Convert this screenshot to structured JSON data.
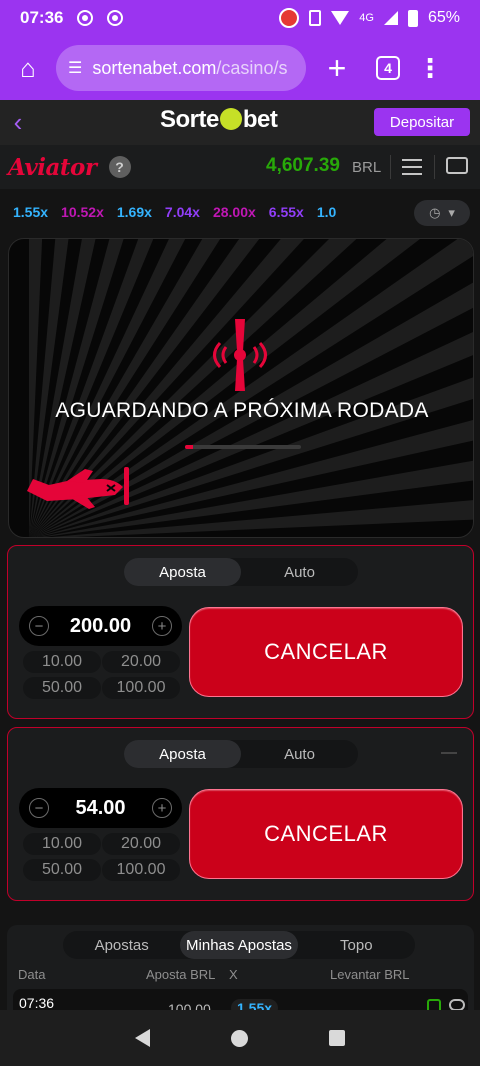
{
  "status_bar": {
    "time": "07:36",
    "network": "4G",
    "battery": "65%"
  },
  "browser": {
    "url_host": "sortenabet.com",
    "url_path": "/casino/s",
    "tab_count": "4"
  },
  "site": {
    "logo_left": "Sorte",
    "logo_right": "bet",
    "deposit_label": "Depositar"
  },
  "game_header": {
    "name": "Aviator",
    "help": "?",
    "balance": "4,607.39",
    "currency": "BRL"
  },
  "history_multipliers": [
    {
      "value": "1.55x",
      "color": "#34b4ff"
    },
    {
      "value": "10.52x",
      "color": "#c017b4"
    },
    {
      "value": "1.69x",
      "color": "#34b4ff"
    },
    {
      "value": "7.04x",
      "color": "#913ef8"
    },
    {
      "value": "28.00x",
      "color": "#c017b4"
    },
    {
      "value": "6.55x",
      "color": "#913ef8"
    },
    {
      "value": "1.0",
      "color": "#34b4ff"
    }
  ],
  "game_area": {
    "waiting_text": "AGUARDANDO A PRÓXIMA RODADA",
    "round_progress": 0.07
  },
  "bet_panels": [
    {
      "tab_bet": "Aposta",
      "tab_auto": "Auto",
      "amount": "200.00",
      "quick": [
        "10.00",
        "20.00",
        "50.00",
        "100.00"
      ],
      "cancel_label": "CANCELAR"
    },
    {
      "tab_bet": "Aposta",
      "tab_auto": "Auto",
      "amount": "54.00",
      "quick": [
        "10.00",
        "20.00",
        "50.00",
        "100.00"
      ],
      "cancel_label": "CANCELAR"
    }
  ],
  "bets": {
    "tabs": [
      "Apostas",
      "Minhas Apostas",
      "Topo"
    ],
    "active_tab": "Minhas Apostas",
    "columns": {
      "date": "Data",
      "bet": "Aposta BRL",
      "mult": "X",
      "cashout": "Levantar BRL"
    },
    "rows": [
      {
        "time": "07:36",
        "bet": "100.00",
        "mult": "1.55x"
      }
    ]
  },
  "colors": {
    "brand_purple": "#9b34f0",
    "aviator_red": "#e50539",
    "balance_green": "#28a909",
    "cancel_red": "#cb011a"
  }
}
